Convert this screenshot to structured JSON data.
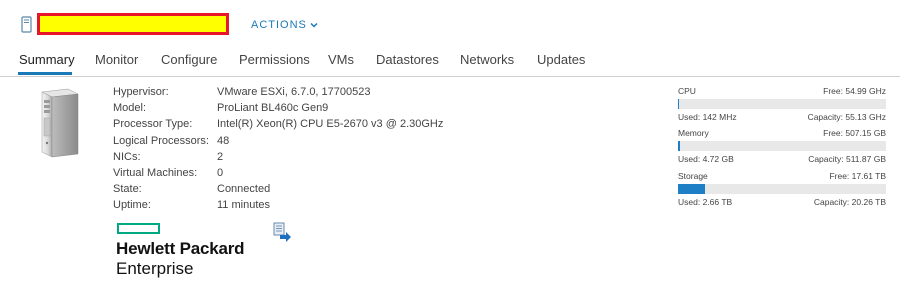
{
  "header": {
    "actions_label": "ACTIONS"
  },
  "tabs": [
    {
      "label": "Summary"
    },
    {
      "label": "Monitor"
    },
    {
      "label": "Configure"
    },
    {
      "label": "Permissions"
    },
    {
      "label": "VMs"
    },
    {
      "label": "Datastores"
    },
    {
      "label": "Networks"
    },
    {
      "label": "Updates"
    }
  ],
  "active_tab": "Summary",
  "info": [
    {
      "key": "Hypervisor:",
      "value": "VMware ESXi, 6.7.0, 17700523"
    },
    {
      "key": "Model:",
      "value": "ProLiant BL460c Gen9"
    },
    {
      "key": "Processor Type:",
      "value": "Intel(R) Xeon(R) CPU E5-2670 v3 @ 2.30GHz"
    },
    {
      "key": "Logical Processors:",
      "value": "48"
    },
    {
      "key": "NICs:",
      "value": "2"
    },
    {
      "key": "Virtual Machines:",
      "value": "0"
    },
    {
      "key": "State:",
      "value": "Connected"
    },
    {
      "key": "Uptime:",
      "value": "11 minutes"
    }
  ],
  "vendor_logo": {
    "line1": "Hewlett Packard",
    "line2": "Enterprise",
    "color": "#01a982"
  },
  "resources": [
    {
      "label": "CPU",
      "free": "Free: 54.99 GHz",
      "used": "Used: 142 MHz",
      "capacity": "Capacity: 55.13 GHz",
      "used_fraction": 0.003
    },
    {
      "label": "Memory",
      "free": "Free: 507.15 GB",
      "used": "Used: 4.72 GB",
      "capacity": "Capacity: 511.87 GB",
      "used_fraction": 0.009
    },
    {
      "label": "Storage",
      "free": "Free: 17.61 TB",
      "used": "Used: 2.66 TB",
      "capacity": "Capacity: 20.26 TB",
      "used_fraction": 0.131
    }
  ],
  "colors": {
    "accent": "#1a7ab8",
    "bar_fill": "#1e7fc7",
    "bar_track": "#e8e8e8",
    "redacted_fill": "#ffff00",
    "redacted_border": "#e8162a"
  }
}
